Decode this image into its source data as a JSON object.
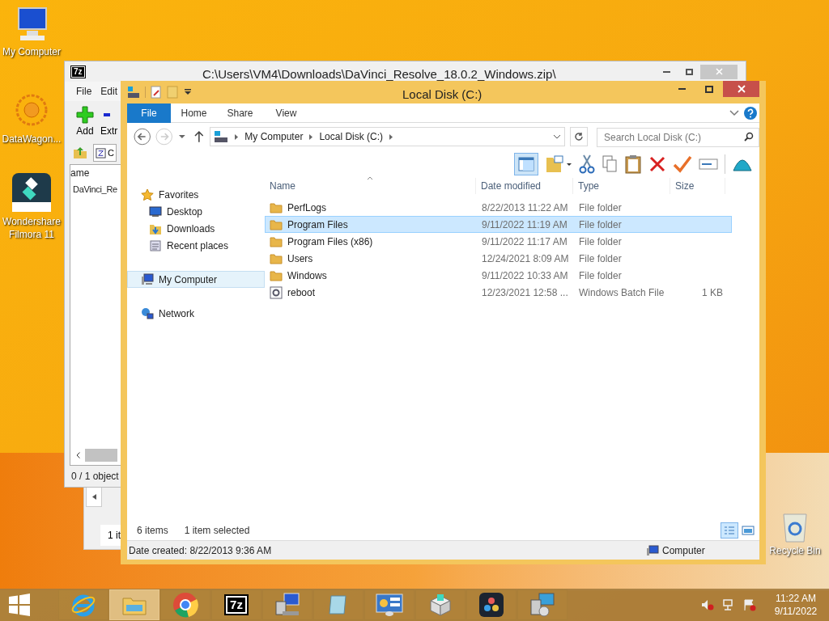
{
  "desktop_icons": [
    {
      "kind": "computer",
      "label": "My Computer"
    },
    {
      "kind": "datawagon",
      "label": "DataWagon..."
    },
    {
      "kind": "filmora",
      "label": "Wondershare Filmora 11"
    }
  ],
  "recycle_bin": {
    "label": "Recycle Bin"
  },
  "small_window": {
    "status": "1 it"
  },
  "sevenzip_window": {
    "icon_text": "7z",
    "title": "C:\\Users\\VM4\\Downloads\\DaVinci_Resolve_18.0.2_Windows.zip\\",
    "menu": [
      "File",
      "Edit"
    ],
    "toolbar": [
      "Add",
      "Extr"
    ],
    "address": "C",
    "column": "ame",
    "rows": [
      "DaVinci_Re"
    ],
    "status": "0 / 1 object"
  },
  "explorer": {
    "title": "Local Disk (C:)",
    "tabs": [
      {
        "label": "File",
        "selected": true
      },
      {
        "label": "Home",
        "selected": false
      },
      {
        "label": "Share",
        "selected": false
      },
      {
        "label": "View",
        "selected": false
      }
    ],
    "breadcrumb": [
      "My Computer",
      "Local Disk (C:)"
    ],
    "search": {
      "placeholder": "Search Local Disk (C:)"
    },
    "nav": [
      {
        "kind": "favorites",
        "label": "Favorites",
        "selected": false,
        "children": [
          {
            "kind": "desktop",
            "label": "Desktop",
            "selected": false
          },
          {
            "kind": "downloads",
            "label": "Downloads",
            "selected": false
          },
          {
            "kind": "recent",
            "label": "Recent places",
            "selected": false
          }
        ]
      },
      {
        "kind": "computer",
        "label": "My Computer",
        "selected": true
      },
      {
        "kind": "network",
        "label": "Network",
        "selected": false
      }
    ],
    "columns": [
      "Name",
      "Date modified",
      "Type",
      "Size"
    ],
    "rows": [
      {
        "kind": "folder",
        "name": "PerfLogs",
        "date": "8/22/2013 11:22 AM",
        "type": "File folder",
        "selected": false
      },
      {
        "kind": "folder",
        "name": "Program Files",
        "date": "9/11/2022 11:19 AM",
        "type": "File folder",
        "selected": true
      },
      {
        "kind": "folder",
        "name": "Program Files (x86)",
        "date": "9/11/2022 11:17 AM",
        "type": "File folder",
        "selected": false
      },
      {
        "kind": "folder",
        "name": "Users",
        "date": "12/24/2021 8:09 AM",
        "type": "File folder",
        "selected": false
      },
      {
        "kind": "folder",
        "name": "Windows",
        "date": "9/11/2022 10:33 AM",
        "type": "File folder",
        "selected": false
      },
      {
        "kind": "batch",
        "name": "reboot",
        "date": "12/23/2021 12:58 ...",
        "type": "Windows Batch File",
        "size": "1 KB",
        "selected": false
      }
    ],
    "status": {
      "count": "6 items",
      "selection": "1 item selected"
    },
    "details": {
      "text": "Date created: 8/22/2013 9:36 AM",
      "location": "Computer"
    }
  },
  "taskbar": {
    "apps": [
      {
        "kind": "ie",
        "selected": false
      },
      {
        "kind": "explorer",
        "selected": true
      },
      {
        "kind": "chrome",
        "selected": false
      },
      {
        "kind": "sevenzip",
        "icon_text": "7z",
        "selected": false
      },
      {
        "kind": "setup",
        "selected": false
      },
      {
        "kind": "notepad",
        "selected": false
      },
      {
        "kind": "panel",
        "selected": false
      },
      {
        "kind": "filmora",
        "selected": false
      },
      {
        "kind": "resolve",
        "selected": false
      },
      {
        "kind": "installer",
        "selected": false
      }
    ],
    "time": "11:22 AM",
    "date": "9/11/2022"
  }
}
